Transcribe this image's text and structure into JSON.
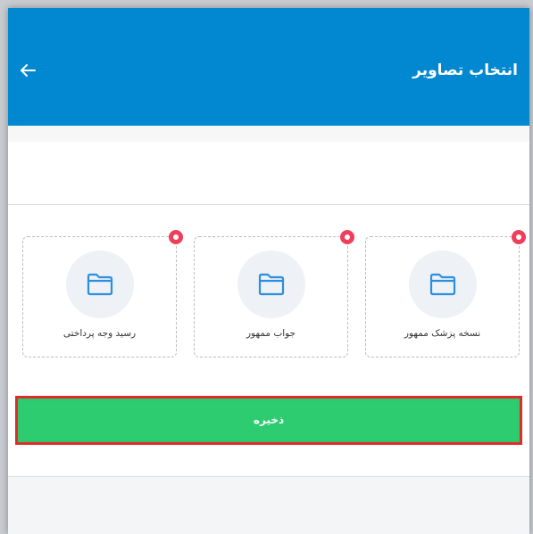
{
  "header": {
    "title": "انتخاب تصاویر",
    "back_icon": "arrow-left-icon",
    "background_color": "#0288d1"
  },
  "upload_cards": [
    {
      "label": "نسخه پزشک ممهور",
      "icon": "folder-icon",
      "remove_icon": "remove-dot-icon"
    },
    {
      "label": "جواب ممهور",
      "icon": "folder-icon",
      "remove_icon": "remove-dot-icon"
    },
    {
      "label": "رسید وجه پرداختی",
      "icon": "folder-icon",
      "remove_icon": "remove-dot-icon"
    }
  ],
  "save_button": {
    "label": "ذخیره",
    "background_color": "#2ecc71",
    "highlight_color": "#e02b2b"
  },
  "colors": {
    "folder_icon": "#2b8fe0",
    "remove_dot": "#ef3e5a"
  }
}
